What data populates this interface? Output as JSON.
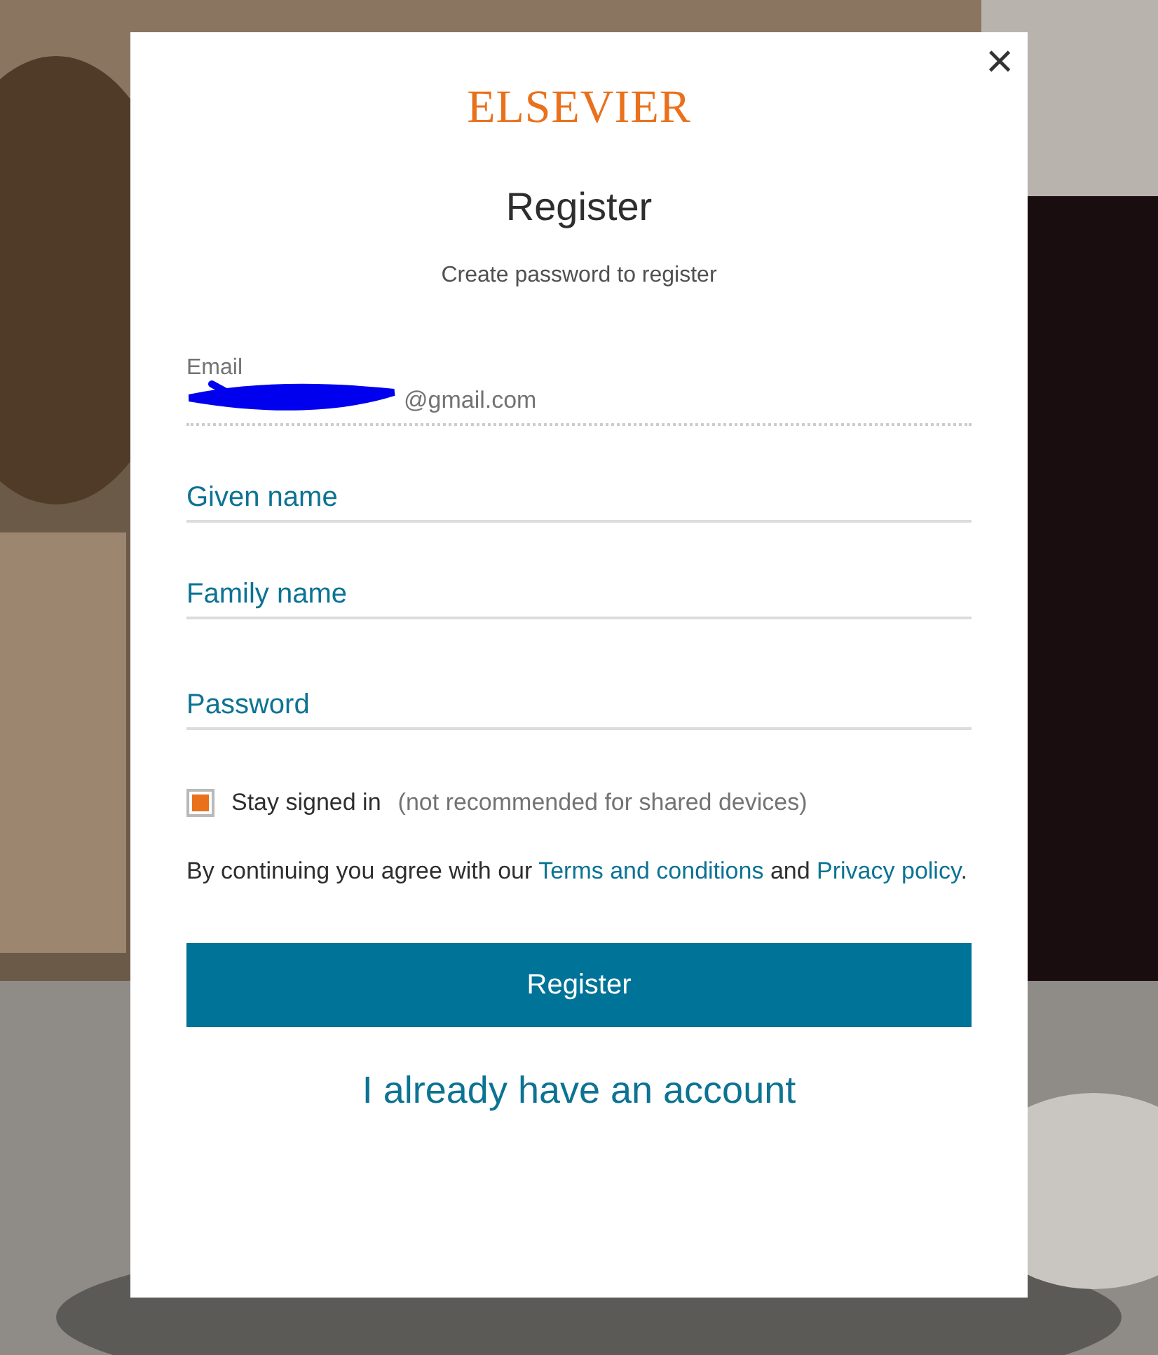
{
  "dialog": {
    "logo": "ELSEVIER",
    "close": "×",
    "title": "Register",
    "subtitle": "Create password to register"
  },
  "email": {
    "label": "Email",
    "value": "@gmail.com",
    "redacted": true
  },
  "fields": [
    {
      "placeholder": "Given name",
      "kind": "text"
    },
    {
      "placeholder": "Family name",
      "kind": "text"
    },
    {
      "placeholder": "Password",
      "kind": "password"
    }
  ],
  "stay_signed_in": {
    "label": "Stay signed in",
    "hint": "(not recommended for shared devices)",
    "checked": true
  },
  "agreement": [
    {
      "kind": "text",
      "text": "By continuing you agree with our "
    },
    {
      "kind": "link",
      "text": "Terms and conditions"
    },
    {
      "kind": "text",
      "text": " and "
    },
    {
      "kind": "link",
      "text": "Privacy policy"
    },
    {
      "kind": "text",
      "text": "."
    }
  ],
  "submit": "Register",
  "account_link": "I already have an account"
}
